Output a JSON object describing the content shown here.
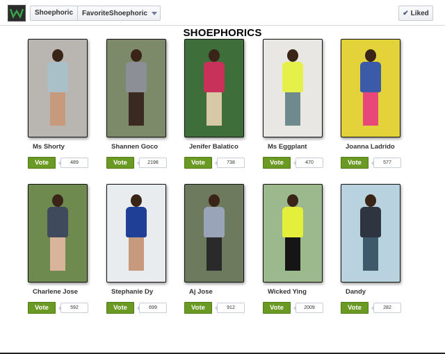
{
  "header": {
    "page_name": "Shoephoric",
    "tab_name": "FavoriteShoephoric",
    "liked_label": "Liked",
    "logo_icon": "shoephoric-logo-icon"
  },
  "title": "SHOEPHORICS",
  "vote_label": "Vote",
  "contestants": [
    {
      "name": "Ms Shorty",
      "votes": "489",
      "bg": "#b9b5b0",
      "top": "#a9c0c9",
      "legs": "#c89a7d"
    },
    {
      "name": "Shannen Goco",
      "votes": "2198",
      "bg": "#7c8a6a",
      "top": "#8d8f96",
      "legs": "#3a2a22"
    },
    {
      "name": "Jenifer Balatico",
      "votes": "738",
      "bg": "#3e6e3a",
      "top": "#c8325a",
      "legs": "#d8c9a6"
    },
    {
      "name": "Ms Eggplant",
      "votes": "470",
      "bg": "#e9e7e3",
      "top": "#e5f04a",
      "legs": "#6e8a8c"
    },
    {
      "name": "Joanna Ladrido",
      "votes": "577",
      "bg": "#e3d23a",
      "top": "#3b5aa8",
      "legs": "#e8477a"
    },
    {
      "name": "Charlene Jose",
      "votes": "592",
      "bg": "#6f8a4e",
      "top": "#3f4a5c",
      "legs": "#d8b49a"
    },
    {
      "name": "Stephanie Dy",
      "votes": "699",
      "bg": "#e8ecef",
      "top": "#1f3f96",
      "legs": "#c89a7d"
    },
    {
      "name": "Aj Jose",
      "votes": "912",
      "bg": "#6d7a5e",
      "top": "#9aa4b8",
      "legs": "#2a2a2a"
    },
    {
      "name": "Wicked Ying",
      "votes": "2009",
      "bg": "#9bb98c",
      "top": "#e3ef3a",
      "legs": "#151515"
    },
    {
      "name": "Dandy",
      "votes": "282",
      "bg": "#b9d2e0",
      "top": "#2e3440",
      "legs": "#3e5a6a"
    }
  ]
}
